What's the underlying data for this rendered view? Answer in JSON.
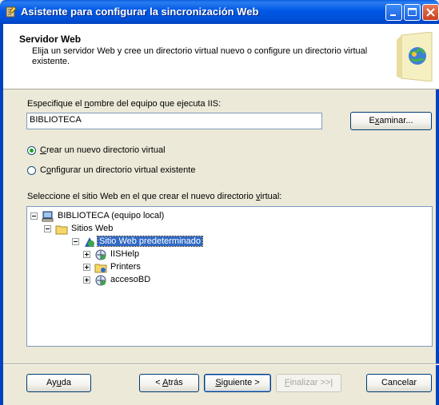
{
  "window": {
    "title": "Asistente para configurar la sincronización Web"
  },
  "header": {
    "title": "Servidor Web",
    "description": "Elija un servidor Web y cree un directorio virtual nuevo o configure un directorio virtual existente."
  },
  "computer": {
    "label_pre": "Especifique el ",
    "label_u": "n",
    "label_post": "ombre del equipo que ejecuta IIS:",
    "value": "BIBLIOTECA",
    "browse_pre": "E",
    "browse_u": "x",
    "browse_post": "aminar..."
  },
  "options": {
    "create_u": "C",
    "create_rest": "rear un nuevo directorio virtual",
    "create_selected": true,
    "configure_pre": "C",
    "configure_u": "o",
    "configure_post": "nfigurar un directorio virtual existente",
    "configure_selected": false
  },
  "site_select": {
    "label_pre": "Seleccione el sitio Web en el que crear el nuevo directorio ",
    "label_u": "v",
    "label_post": "irtual:"
  },
  "tree": {
    "root": "BIBLIOTECA (equipo local)",
    "sites": "Sitios Web",
    "default_site": "Sitio Web predeterminado",
    "children": [
      "IISHelp",
      "Printers",
      "accesoBD"
    ]
  },
  "buttons": {
    "help_pre": "Ay",
    "help_u": "u",
    "help_post": "da",
    "back_pre": "< ",
    "back_u": "A",
    "back_post": "trás",
    "next_u": "S",
    "next_post": "iguiente >",
    "finish_u": "F",
    "finish_post": "inalizar >>|",
    "cancel": "Cancelar"
  },
  "colors": {
    "titlebar": "#0058e6",
    "selection": "#316ac5",
    "dialog_bg": "#ece9d8"
  }
}
